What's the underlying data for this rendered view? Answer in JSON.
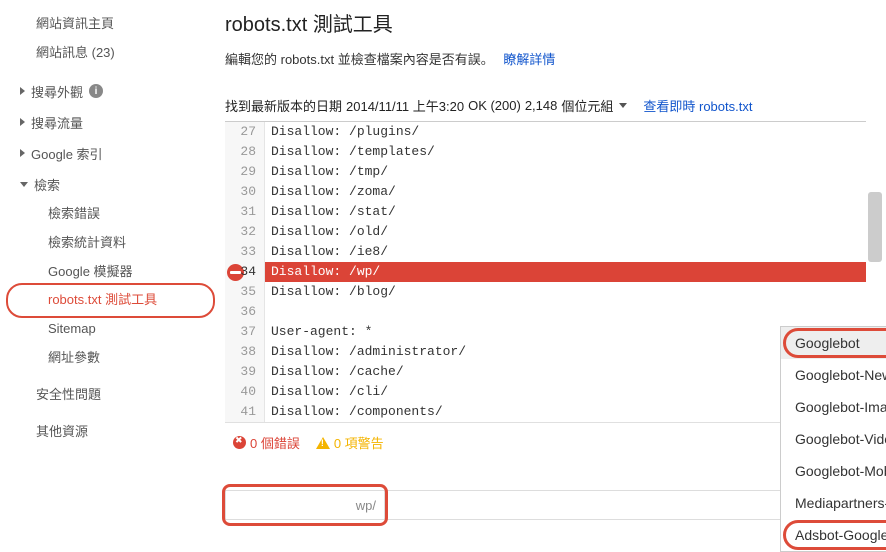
{
  "sidebar": {
    "siteInfoHome": "網站資訊主頁",
    "siteMessages": "網站訊息 (23)",
    "searchAppearance": "搜尋外觀",
    "searchTraffic": "搜尋流量",
    "googleIndex": "Google 索引",
    "crawl": "檢索",
    "crawlItems": {
      "errors": "檢索錯誤",
      "stats": "檢索統計資料",
      "simulator": "Google 模擬器",
      "robots": "robots.txt 測試工具",
      "sitemap": "Sitemap",
      "urlParams": "網址參數"
    },
    "security": "安全性問題",
    "other": "其他資源"
  },
  "header": {
    "title": "robots.txt 測試工具",
    "subtitle": "編輯您的 robots.txt 並檢查檔案內容是否有誤。",
    "learnMore": "瞭解詳情"
  },
  "version": {
    "prefix": "找到最新版本的日期 ",
    "timestamp": "2014/11/11 上午3:20",
    "status": " OK (200) ",
    "bytes": "2,148",
    "bytesUnit": " 個位元組",
    "liveLink": "查看即時 robots.txt"
  },
  "code": {
    "startLine": 27,
    "lines": [
      "Disallow: /plugins/",
      "Disallow: /templates/",
      "Disallow: /tmp/",
      "Disallow: /zoma/",
      "Disallow: /stat/",
      "Disallow: /old/",
      "Disallow: /ie8/",
      "Disallow: /wp/",
      "Disallow: /blog/",
      "",
      "User-agent: *",
      "Disallow: /administrator/",
      "Disallow: /cache/",
      "Disallow: /cli/",
      "Disallow: /components/"
    ],
    "errorLineIndex": 7
  },
  "status": {
    "errors": "0 個錯誤",
    "warnings": "0 項警告"
  },
  "test": {
    "baseSuffix": "wp/",
    "path": ""
  },
  "botMenu": {
    "items": [
      "Googlebot",
      "Googlebot-News",
      "Googlebot-Image",
      "Googlebot-Video",
      "Googlebot-Mobile",
      "Mediapartners-Google",
      "Adsbot-Google"
    ],
    "highlightFirst": 0,
    "highlightLast": 6
  }
}
